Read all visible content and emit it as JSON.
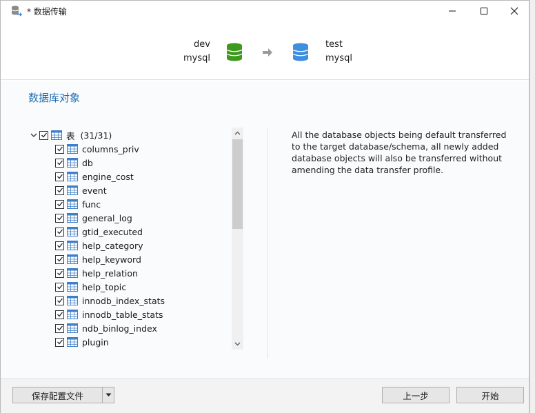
{
  "window": {
    "title": "* 数据传输",
    "controls": {
      "minimize": "minimize-icon",
      "maximize": "maximize-icon",
      "close": "close-icon"
    }
  },
  "header": {
    "source": {
      "connection": "dev",
      "database": "mysql",
      "color": "#3d9a1e"
    },
    "target": {
      "connection": "test",
      "database": "mysql",
      "color": "#3f8fe0"
    }
  },
  "section_title": "数据库对象",
  "tree": {
    "root": {
      "label": "表",
      "count": "(31/31)",
      "expanded": true,
      "checked": true
    },
    "items": [
      {
        "label": "columns_priv",
        "checked": true
      },
      {
        "label": "db",
        "checked": true
      },
      {
        "label": "engine_cost",
        "checked": true
      },
      {
        "label": "event",
        "checked": true
      },
      {
        "label": "func",
        "checked": true
      },
      {
        "label": "general_log",
        "checked": true
      },
      {
        "label": "gtid_executed",
        "checked": true
      },
      {
        "label": "help_category",
        "checked": true
      },
      {
        "label": "help_keyword",
        "checked": true
      },
      {
        "label": "help_relation",
        "checked": true
      },
      {
        "label": "help_topic",
        "checked": true
      },
      {
        "label": "innodb_index_stats",
        "checked": true
      },
      {
        "label": "innodb_table_stats",
        "checked": true
      },
      {
        "label": "ndb_binlog_index",
        "checked": true
      },
      {
        "label": "plugin",
        "checked": true
      }
    ]
  },
  "description": "All the database objects being default transferred to the target database/schema, all newly added database objects will also be transferred without amending the data transfer profile.",
  "footer": {
    "save_profile": "保存配置文件",
    "previous": "上一步",
    "start": "开始"
  },
  "colors": {
    "accent": "#1f6fb5"
  }
}
